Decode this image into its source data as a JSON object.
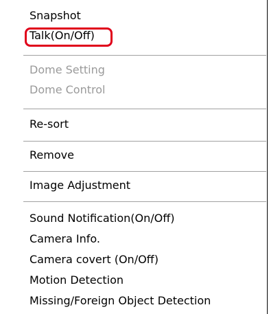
{
  "context_menu": {
    "items": [
      {
        "label": "Snapshot",
        "enabled": true
      },
      {
        "label": "Talk(On/Off)",
        "enabled": true,
        "highlighted": true
      },
      {
        "label": "Dome Setting",
        "enabled": false
      },
      {
        "label": "Dome Control",
        "enabled": false
      },
      {
        "label": "Re-sort",
        "enabled": true
      },
      {
        "label": "Remove",
        "enabled": true
      },
      {
        "label": "Image Adjustment",
        "enabled": true
      },
      {
        "label": "Sound Notification(On/Off)",
        "enabled": true
      },
      {
        "label": "Camera Info.",
        "enabled": true
      },
      {
        "label": "Camera covert (On/Off)",
        "enabled": true
      },
      {
        "label": "Motion Detection",
        "enabled": true
      },
      {
        "label": "Missing/Foreign Object Detection",
        "enabled": true
      }
    ]
  },
  "colors": {
    "highlight_border": "#e0001a",
    "disabled_text": "#9a9a9a",
    "separator": "#a0a0a0"
  }
}
